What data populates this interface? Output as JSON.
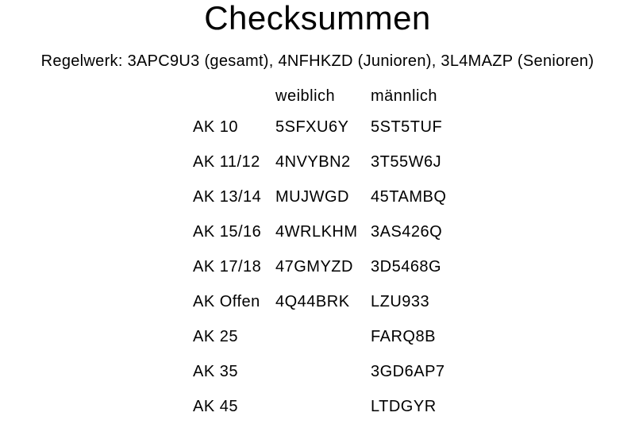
{
  "title": "Checksummen",
  "rules_line": "Regelwerk: 3APC9U3 (gesamt), 4NFHKZD (Junioren), 3L4MAZP (Senioren)",
  "table": {
    "headers": [
      "",
      "weiblich",
      "männlich"
    ],
    "rows": [
      {
        "ak": "AK 10",
        "weiblich": "5SFXU6Y",
        "maennlich": "5ST5TUF"
      },
      {
        "ak": "AK 11/12",
        "weiblich": "4NVYBN2",
        "maennlich": "3T55W6J"
      },
      {
        "ak": "AK 13/14",
        "weiblich": "MUJWGD",
        "maennlich": "45TAMBQ"
      },
      {
        "ak": "AK 15/16",
        "weiblich": "4WRLKHM",
        "maennlich": "3AS426Q"
      },
      {
        "ak": "AK 17/18",
        "weiblich": "47GMYZD",
        "maennlich": "3D5468G"
      },
      {
        "ak": "AK Offen",
        "weiblich": "4Q44BRK",
        "maennlich": "LZU933"
      },
      {
        "ak": "AK 25",
        "weiblich": "",
        "maennlich": "FARQ8B"
      },
      {
        "ak": "AK 35",
        "weiblich": "",
        "maennlich": "3GD6AP7"
      },
      {
        "ak": "AK 45",
        "weiblich": "",
        "maennlich": "LTDGYR"
      }
    ]
  }
}
